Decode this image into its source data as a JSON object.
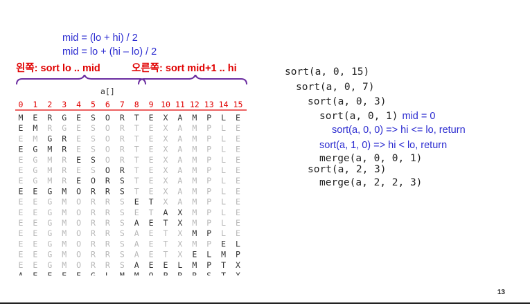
{
  "formulas": [
    "mid = (lo + hi) / 2",
    "mid = lo + (hi – lo) / 2"
  ],
  "labels": {
    "left": "왼쪽: sort lo .. mid",
    "right": "오른쪽: sort mid+1 .. hi"
  },
  "array_title": "a[]",
  "indices": [
    "0",
    "1",
    "2",
    "3",
    "4",
    "5",
    "6",
    "7",
    "8",
    "9",
    "10",
    "11",
    "12",
    "13",
    "14",
    "15"
  ],
  "rows": [
    {
      "letters": "MERGESORTEXAMPLE",
      "dark": [
        0,
        15
      ]
    },
    {
      "letters": "EMRGESORTEXAMPLE",
      "dark": [
        0,
        1
      ]
    },
    {
      "letters": "EMGRESORTEXAMPLE",
      "dark": [
        2,
        3
      ]
    },
    {
      "letters": "EGMRESORTEXAMPLE",
      "dark": [
        0,
        3
      ]
    },
    {
      "letters": "EGMRESORTEXAMPLE",
      "dark": [
        4,
        5
      ]
    },
    {
      "letters": "EGMRESORTEXAMPLE",
      "dark": [
        6,
        7
      ]
    },
    {
      "letters": "EGMREORSTEXAMPLE",
      "dark": [
        4,
        7
      ]
    },
    {
      "letters": "EEGMORRSTEXAMPLE",
      "dark": [
        0,
        7
      ]
    },
    {
      "letters": "EEGMORRSETXAMPLE",
      "dark": [
        8,
        9
      ]
    },
    {
      "letters": "EEGMORRSETAXMPLE",
      "dark": [
        10,
        11
      ]
    },
    {
      "letters": "EEGMORRSAETXMPLE",
      "dark": [
        8,
        11
      ]
    },
    {
      "letters": "EEGMORRSAETXMPLE",
      "dark": [
        12,
        13
      ]
    },
    {
      "letters": "EEGMORRSAETXMPEL",
      "dark": [
        14,
        15
      ]
    },
    {
      "letters": "EEGMORRSAETXELMP",
      "dark": [
        12,
        15
      ]
    },
    {
      "letters": "EEGMORRSAEELMPTX",
      "dark": [
        8,
        15
      ]
    },
    {
      "letters": "AEEEEGLMMOPRRSTX",
      "dark": [
        0,
        15
      ]
    }
  ],
  "colors": {
    "blue": "#2b2bd0",
    "red": "#e00000",
    "dark": "#333333",
    "light": "#b8b8b8",
    "brace": "#6a2ca0"
  },
  "trace": [
    {
      "text": "sort(a, 0, 15)",
      "style": "mono"
    },
    {
      "text": "sort(a, 0, 7)",
      "style": "mono"
    },
    {
      "text": "sort(a, 0, 3)",
      "style": "mono"
    },
    {
      "text": "sort(a, 0, 1)",
      "style": "mono",
      "note": "mid = 0"
    },
    {
      "text": "sort(a, 0, 0) => hi <= lo, return",
      "style": "blue"
    },
    {
      "text": "sort(a, 1, 0) => hi < lo, return",
      "style": "blue"
    },
    {
      "text": "merge(a, 0, 0, 1)",
      "style": "mono"
    },
    {
      "text": "sort(a, 2, 3)",
      "style": "mono"
    },
    {
      "text": "merge(a, 2, 2, 3)",
      "style": "mono"
    }
  ],
  "page_number": "13"
}
